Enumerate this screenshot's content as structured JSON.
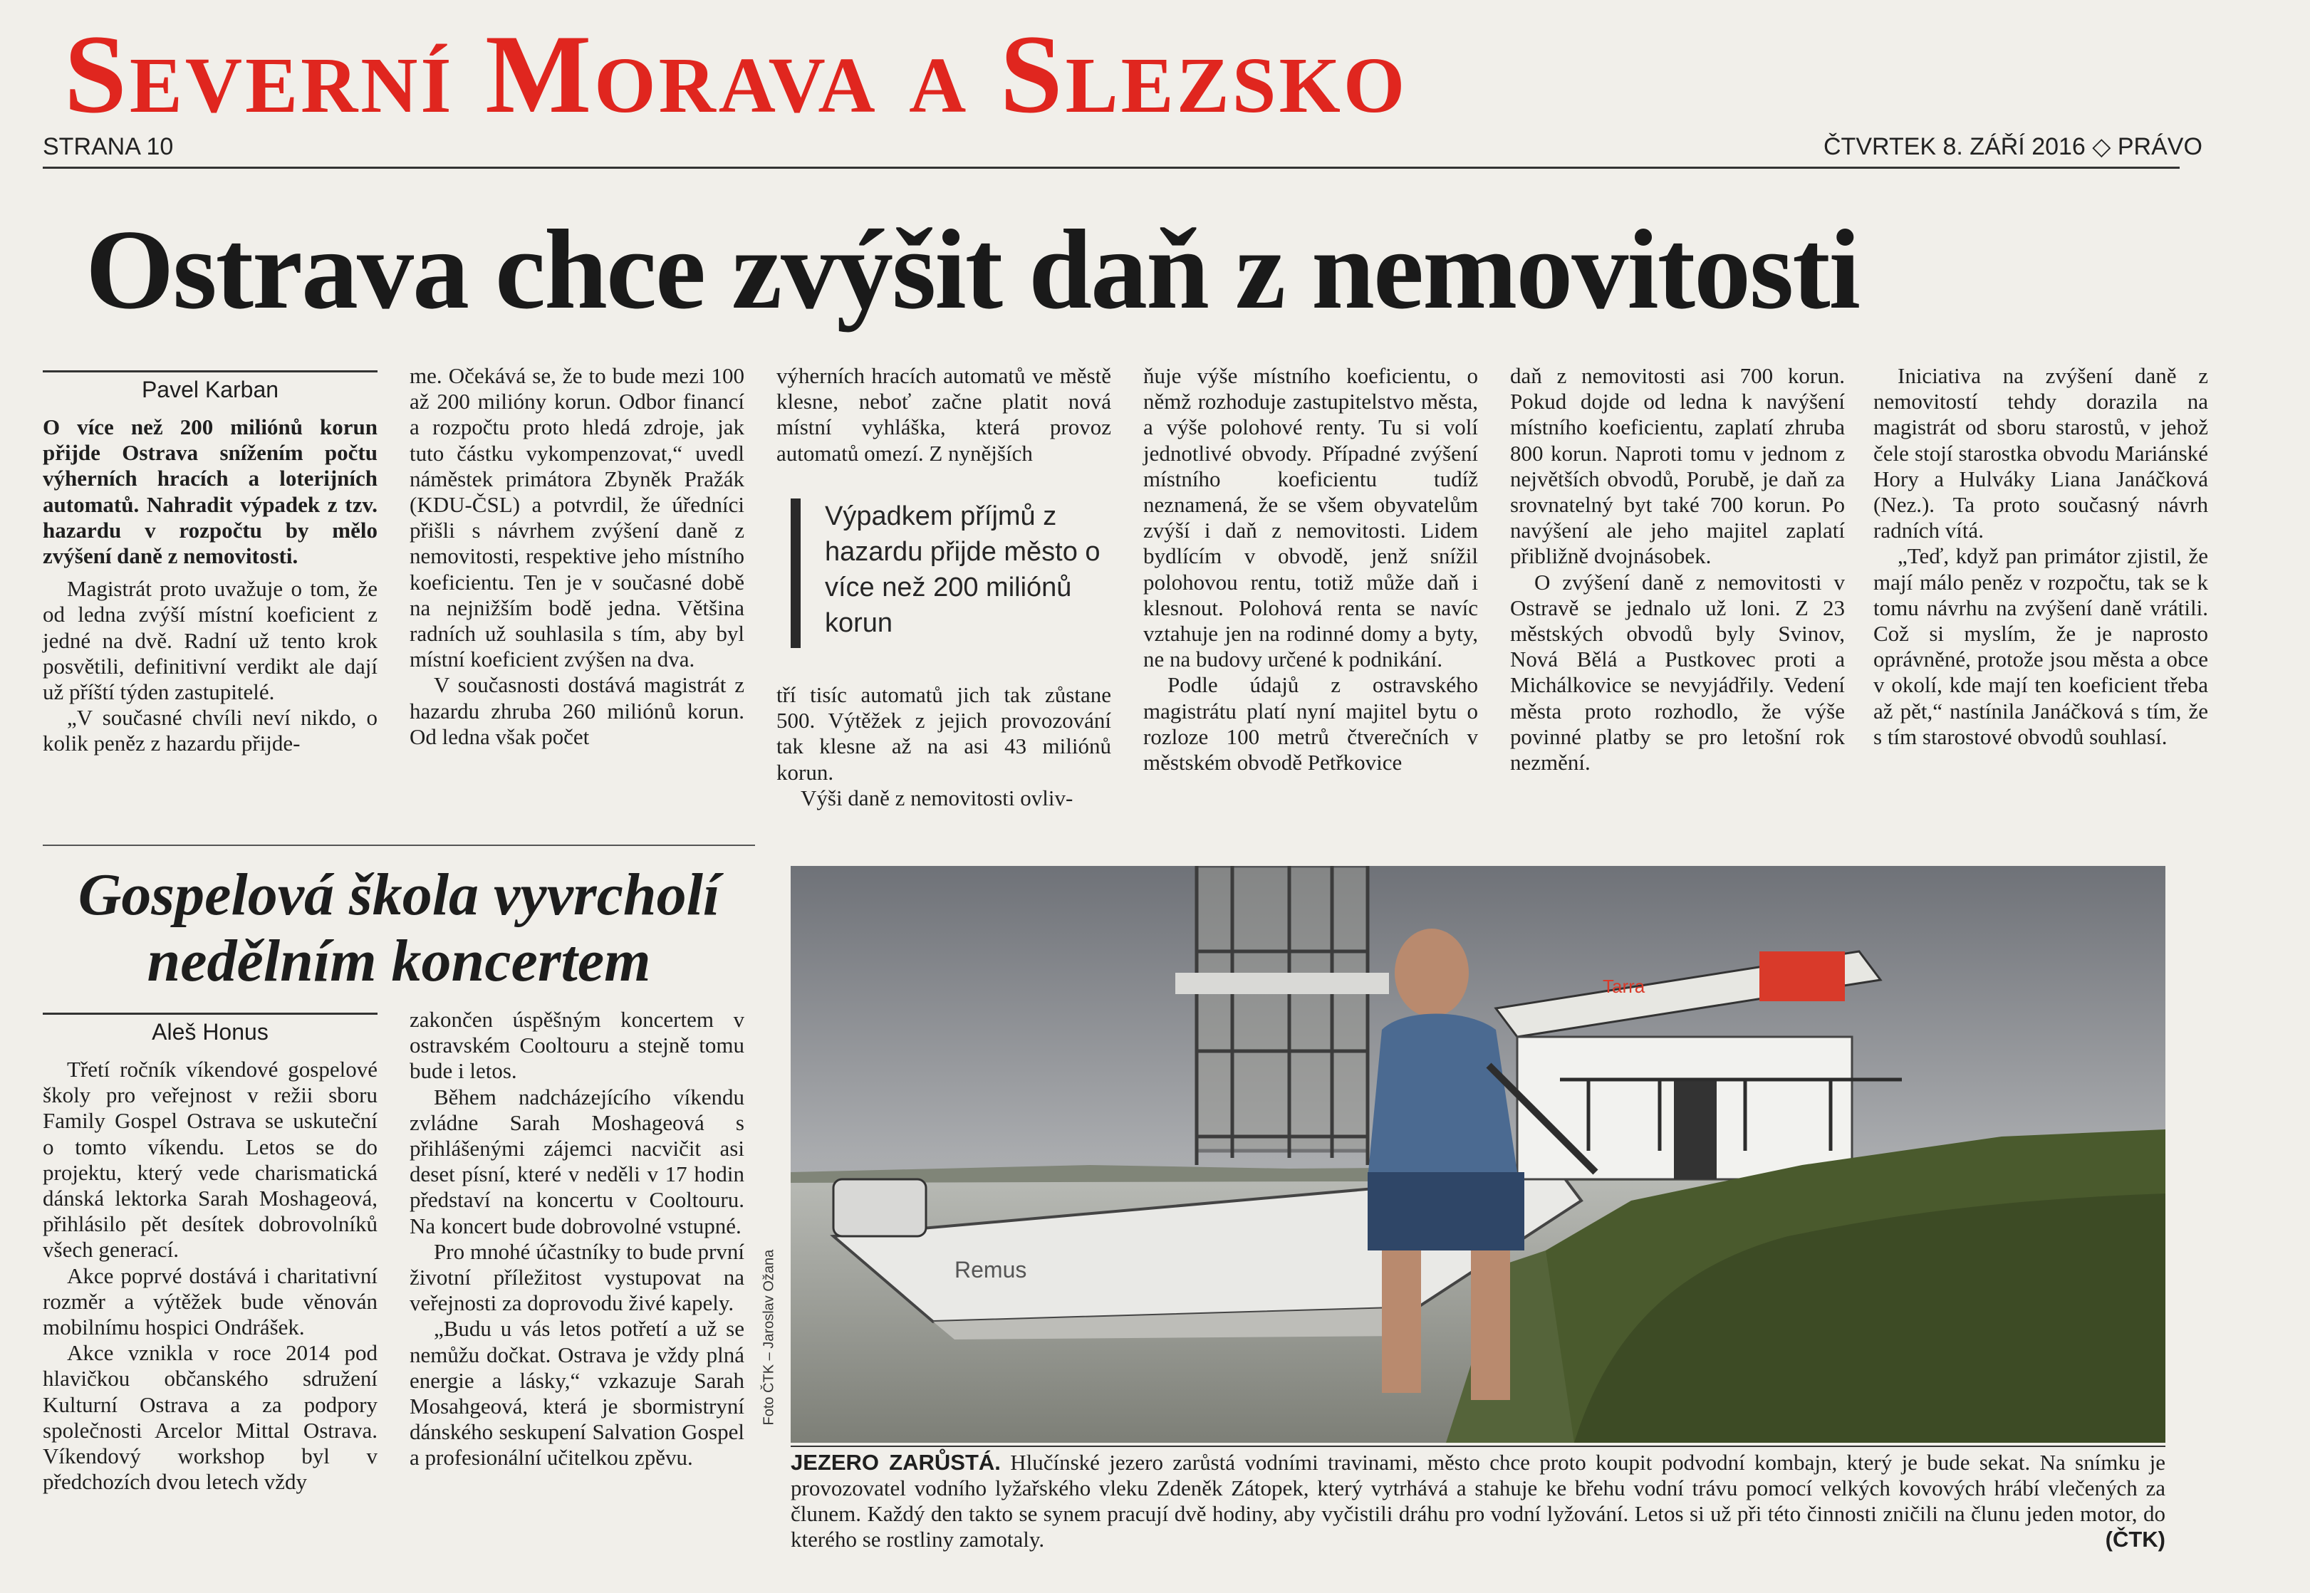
{
  "masthead": "Severní Morava a Slezsko",
  "page_label": "STRANA 10",
  "date_label": "ČTVRTEK 8. ZÁŘÍ 2016 ◇ PRÁVO",
  "article1": {
    "headline": "Ostrava chce zvýšit daň z nemovitosti",
    "author": "Pavel Karban",
    "lead": "O více než 200 miliónů korun přijde Ostrava snížením počtu výherních hracích a loterijních automatů. Nahradit výpadek z tzv. hazardu v rozpočtu by mělo zvýšení daně z nemovitosti.",
    "col1": [
      "Magistrát proto uvažuje o tom, že od ledna zvýší místní koeficient z jedné na dvě. Radní už tento krok posvětili, definitivní verdikt ale dají už příští týden zastupitelé.",
      "„V současné chvíli neví nikdo, o kolik peněz z hazardu přijde-"
    ],
    "col2": [
      "me. Očekává se, že to bude mezi 100 až 200 milióny korun. Odbor financí a rozpočtu proto hledá zdroje, jak tuto částku vykompenzovat,“ uvedl náměstek primátora Zbyněk Pražák (KDU-ČSL) a potvrdil, že úředníci přišli s návrhem zvýšení daně z nemovitosti, respektive jeho místního koeficientu. Ten je v současné době na nejnižším bodě jedna. Většina radních už souhlasila s tím, aby byl místní koeficient zvýšen na dva.",
      "V současnosti dostává magistrát z hazardu zhruba 260 miliónů korun. Od ledna však počet"
    ],
    "col3a": "výherních hracích automatů ve městě klesne, neboť začne platit nová místní vyhláška, která provoz automatů omezí. Z nynějších",
    "col3b": [
      "tří tisíc automatů jich tak zůstane 500. Výtěžek z jejich provozování tak klesne až na asi 43 miliónů korun.",
      "Výši daně z nemovitosti ovliv-"
    ],
    "pullquote": "Výpadkem příjmů z hazardu přijde město o více než 200 miliónů korun",
    "col4": [
      "ňuje výše místního koeficientu, o němž rozhoduje zastupitelstvo města, a výše polohové renty. Tu si volí jednotlivé obvody. Případné zvýšení místního koeficientu tudíž neznamená, že se všem obyvatelům zvýší i daň z nemovitosti. Lidem bydlícím v obvodě, jenž snížil polohovou rentu, totiž může daň i klesnout. Polohová renta se navíc vztahuje jen na rodinné domy a byty, ne na budovy určené k podnikání.",
      "Podle údajů z ostravského magistrátu platí nyní majitel bytu o rozloze 100 metrů čtverečních v městském obvodě Petřkovice"
    ],
    "col5": [
      "daň z nemovitosti asi 700 korun. Pokud dojde od ledna k navýšení místního koeficientu, zaplatí zhruba 800 korun. Naproti tomu v jednom z největších obvodů, Porubě, je daň za srovnatelný byt také 700 korun. Po navýšení ale jeho majitel zaplatí přibližně dvojnásobek.",
      "O zvýšení daně z nemovitosti v Ostravě se jednalo už loni. Z 23 městských obvodů byly Svinov, Nová Bělá a Pustkovec proti a Michálkovice se nevyjádřily. Vedení města proto rozhodlo, že výše povinné platby se pro letošní rok nezmění."
    ],
    "col6": [
      "Iniciativa na zvýšení daně z nemovitostí tehdy dorazila na magistrát od sboru starostů, v jehož čele stojí starostka obvodu Mariánské Hory a Hulváky Liana Janáčková (Nez.). Ta proto současný návrh radních vítá.",
      "„Teď, když pan primátor zjistil, že mají málo peněz v rozpočtu, tak se k tomu návrhu na zvýšení daně vrátili. Což si myslím, že je naprosto oprávněné, protože jsou města a obce v okolí, kde mají ten koeficient třeba až pět,“ nastínila Janáčková s tím, že s tím starostové obvodů souhlasí."
    ]
  },
  "article2": {
    "headline": "Gospelová škola vyvrcholí nedělním koncertem",
    "author": "Aleš Honus",
    "col1": [
      "Třetí ročník víkendové gospelové školy pro veřejnost v režii sboru Family Gospel Ostrava se uskuteční o tomto víkendu. Letos se do projektu, který vede charismatická dánská lektorka Sarah Moshageová, přihlásilo pět desítek dobrovolníků všech generací.",
      "Akce poprvé dostává i charitativní rozměr a výtěžek bude věnován mobilnímu hospici Ondrášek.",
      "Akce vznikla v roce 2014 pod hlavičkou občanského sdružení Kulturní Ostrava a za podpory společnosti Arcelor Mittal Ostrava. Víkendový workshop byl v předchozích dvou letech vždy"
    ],
    "col2": [
      "zakončen úspěšným koncertem v ostravském Cooltouru a stejně tomu bude i letos.",
      "Během nadcházejícího víkendu zvládne Sarah Moshageová s přihlášenými zájemci nacvičit asi deset písní, které v neděli v 17 hodin představí na koncertu v Cooltouru. Na koncert bude dobrovolné vstupné.",
      "Pro mnohé účastníky to bude první životní příležitost vystupovat na veřejnosti za doprovodu živé kapely.",
      "„Budu u vás letos potřetí a už se nemůžu dočkat. Ostrava je vždy plná energie a lásky,“ vzkazuje Sarah Mosahgeová, která je sbormistryní dánského seskupení Salvation Gospel a profesionální učitelkou zpěvu."
    ]
  },
  "photo": {
    "credit": "Foto ČTK – Jaroslav Ožana",
    "caption_title": "JEZERO ZARŮSTÁ.",
    "caption_text": "Hlučínské jezero zarůstá vodními travinami, město chce proto koupit podvodní kombajn, který je bude sekat. Na snímku je provozovatel vodního lyžařského vleku Zdeněk Zátopek, který vytrhává a stahuje ke břehu vodní trávu pomocí velkých kovových hrábí vlečených za člunem. Každý den takto se synem pracují dvě hodiny, aby vyčistili dráhu pro vodní lyžování. Letos si už při této činnosti zničili na člunu jeden motor, do kterého se rostliny zamotaly.",
    "caption_source": "(ČTK)",
    "boat_name": "Remus",
    "sign_brand": "Tarra"
  },
  "colors": {
    "masthead": "#e0261f",
    "paper": "#f1efea",
    "text": "#1d1d1d"
  }
}
